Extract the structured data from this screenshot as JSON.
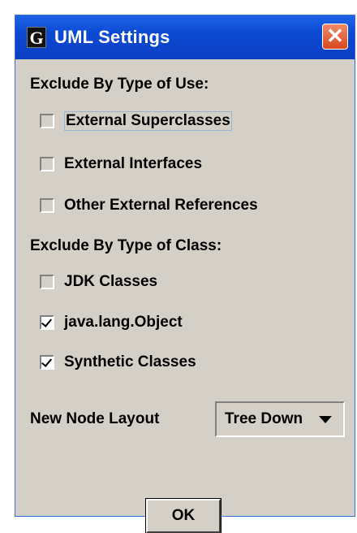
{
  "window": {
    "title": "UML Settings",
    "app_icon_letter": "G",
    "close_glyph": "✕",
    "title_color": "#0a46cf",
    "background": "#d4d0c8"
  },
  "type_of_use": {
    "header": "Exclude By Type of Use:",
    "items": [
      {
        "label": "External Superclasses",
        "checked": false
      },
      {
        "label": "External Interfaces",
        "checked": false
      },
      {
        "label": "Other External References",
        "checked": false
      }
    ]
  },
  "type_of_class": {
    "header": "Exclude By Type of Class:",
    "items": [
      {
        "label": "JDK Classes",
        "checked": false
      },
      {
        "label": "java.lang.Object",
        "checked": true
      },
      {
        "label": "Synthetic Classes",
        "checked": true
      }
    ]
  },
  "layout": {
    "label": "New Node Layout",
    "selected": "Tree Down"
  },
  "buttons": {
    "ok_label": "OK"
  }
}
